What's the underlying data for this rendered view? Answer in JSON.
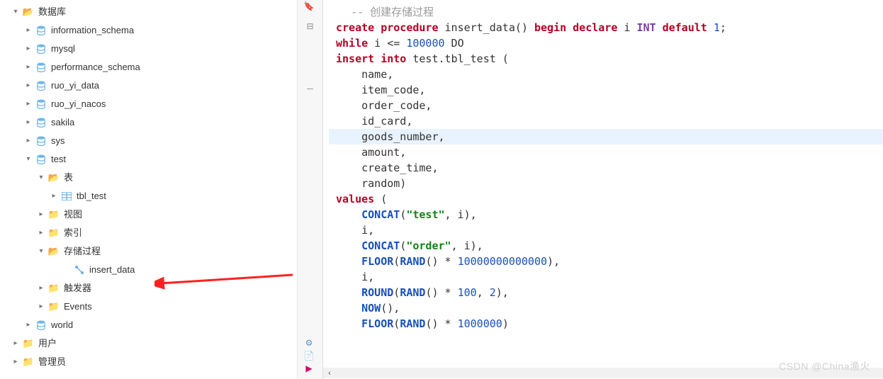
{
  "tree": {
    "root": "数据库",
    "schemas": [
      "information_schema",
      "mysql",
      "performance_schema",
      "ruo_yi_data",
      "ruo_yi_nacos",
      "sakila",
      "sys",
      "test",
      "world"
    ],
    "test": {
      "tables_label": "表",
      "tables": [
        "tbl_test"
      ],
      "views_label": "视图",
      "indexes_label": "索引",
      "procs_label": "存储过程",
      "procs": [
        "insert_data"
      ],
      "triggers_label": "触发器",
      "events_label": "Events"
    },
    "users_label": "用户",
    "admin_label": "管理员"
  },
  "editor": {
    "comment": "-- 创建存储过程",
    "lines": [
      {
        "tokens": [
          {
            "t": "create",
            "c": "kw"
          },
          {
            "t": " procedure ",
            "c": "kw"
          },
          {
            "t": "insert_data",
            "c": "id"
          },
          {
            "t": "() ",
            "c": "op"
          },
          {
            "t": "begin",
            "c": "kw"
          },
          {
            "t": " ",
            "c": "op"
          },
          {
            "t": "declare",
            "c": "kw"
          },
          {
            "t": " i ",
            "c": "id"
          },
          {
            "t": "INT",
            "c": "type"
          },
          {
            "t": " ",
            "c": "op"
          },
          {
            "t": "default",
            "c": "kw"
          },
          {
            "t": " ",
            "c": "op"
          },
          {
            "t": "1",
            "c": "num"
          },
          {
            "t": ";",
            "c": "op"
          }
        ]
      },
      {
        "tokens": [
          {
            "t": "while",
            "c": "kw"
          },
          {
            "t": " i <= ",
            "c": "op"
          },
          {
            "t": "100000",
            "c": "num"
          },
          {
            "t": " DO",
            "c": "op"
          }
        ]
      },
      {
        "bar": true,
        "tokens": [
          {
            "t": "insert",
            "c": "kw"
          },
          {
            "t": " ",
            "c": "op"
          },
          {
            "t": "into",
            "c": "kw"
          },
          {
            "t": " test.tbl_test (",
            "c": "id"
          }
        ]
      },
      {
        "indent": "    ",
        "tokens": [
          {
            "t": "name,",
            "c": "id"
          }
        ]
      },
      {
        "indent": "    ",
        "tokens": [
          {
            "t": "item_code,",
            "c": "id"
          }
        ]
      },
      {
        "indent": "    ",
        "tokens": [
          {
            "t": "order_code,",
            "c": "id"
          }
        ]
      },
      {
        "indent": "    ",
        "tokens": [
          {
            "t": "id_card,",
            "c": "id"
          }
        ]
      },
      {
        "indent": "    ",
        "hl": true,
        "tokens": [
          {
            "t": "goods_number,",
            "c": "id"
          }
        ]
      },
      {
        "indent": "    ",
        "tokens": [
          {
            "t": "amount,",
            "c": "id"
          }
        ]
      },
      {
        "indent": "    ",
        "tokens": [
          {
            "t": "create_time,",
            "c": "id"
          }
        ]
      },
      {
        "indent": "    ",
        "tokens": [
          {
            "t": "random)",
            "c": "id"
          }
        ]
      },
      {
        "bar": true,
        "tokens": [
          {
            "t": "values",
            "c": "kw"
          },
          {
            "t": " (",
            "c": "op"
          }
        ]
      },
      {
        "indent": "    ",
        "tokens": [
          {
            "t": "CONCAT",
            "c": "fn"
          },
          {
            "t": "(",
            "c": "op"
          },
          {
            "t": "\"test\"",
            "c": "str"
          },
          {
            "t": ", i),",
            "c": "op"
          }
        ]
      },
      {
        "indent": "    ",
        "tokens": [
          {
            "t": "i,",
            "c": "op"
          }
        ]
      },
      {
        "indent": "    ",
        "tokens": [
          {
            "t": "CONCAT",
            "c": "fn"
          },
          {
            "t": "(",
            "c": "op"
          },
          {
            "t": "\"order\"",
            "c": "str"
          },
          {
            "t": ", i),",
            "c": "op"
          }
        ]
      },
      {
        "indent": "    ",
        "tokens": [
          {
            "t": "FLOOR",
            "c": "fn"
          },
          {
            "t": "(",
            "c": "op"
          },
          {
            "t": "RAND",
            "c": "fn"
          },
          {
            "t": "() * ",
            "c": "op"
          },
          {
            "t": "10000000000000",
            "c": "num"
          },
          {
            "t": "),",
            "c": "op"
          }
        ]
      },
      {
        "indent": "    ",
        "tokens": [
          {
            "t": "i,",
            "c": "op"
          }
        ]
      },
      {
        "indent": "    ",
        "tokens": [
          {
            "t": "ROUND",
            "c": "fn"
          },
          {
            "t": "(",
            "c": "op"
          },
          {
            "t": "RAND",
            "c": "fn"
          },
          {
            "t": "() * ",
            "c": "op"
          },
          {
            "t": "100",
            "c": "num"
          },
          {
            "t": ", ",
            "c": "op"
          },
          {
            "t": "2",
            "c": "num"
          },
          {
            "t": "),",
            "c": "op"
          }
        ]
      },
      {
        "indent": "    ",
        "tokens": [
          {
            "t": "NOW",
            "c": "fn"
          },
          {
            "t": "(),",
            "c": "op"
          }
        ]
      },
      {
        "indent": "    ",
        "tokens": [
          {
            "t": "FLOOR",
            "c": "fn"
          },
          {
            "t": "(",
            "c": "op"
          },
          {
            "t": "RAND",
            "c": "fn"
          },
          {
            "t": "() * ",
            "c": "op"
          },
          {
            "t": "1000000",
            "c": "num"
          },
          {
            "t": ")",
            "c": "op"
          }
        ]
      }
    ]
  },
  "watermark": "CSDN @China渔火"
}
